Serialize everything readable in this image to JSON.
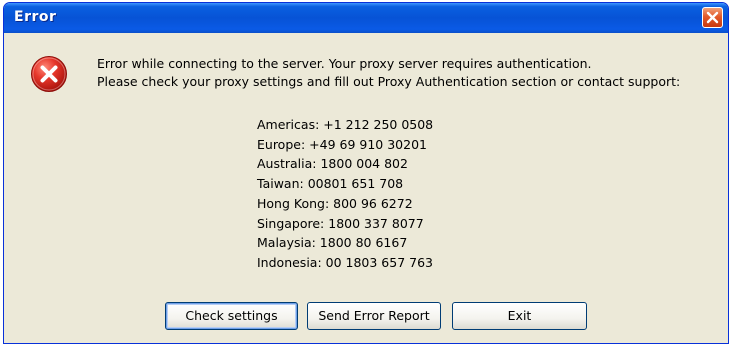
{
  "window": {
    "title": "Error"
  },
  "message": {
    "line1": "Error while connecting to the server. Your proxy server requires authentication.",
    "line2": "Please check your proxy settings and fill out Proxy Authentication section or contact support:"
  },
  "contacts": [
    "Americas: +1 212 250 0508",
    "Europe: +49 69 910 30201",
    "Australia: 1800 004 802",
    "Taiwan: 00801 651 708",
    "Hong Kong: 800 96 6272",
    "Singapore: 1800 337 8077",
    "Malaysia: 1800 80 6167",
    "Indonesia: 00 1803 657 763"
  ],
  "buttons": {
    "check_settings": "Check settings",
    "send_error_report": "Send Error Report",
    "exit": "Exit"
  },
  "icons": {
    "title_close": "close-icon",
    "dialog": "error-icon"
  },
  "colors": {
    "titlebar": "#0753d6",
    "close_button": "#e35a2a",
    "dialog_background": "#ece9d8",
    "error_icon": "#d6221d"
  }
}
